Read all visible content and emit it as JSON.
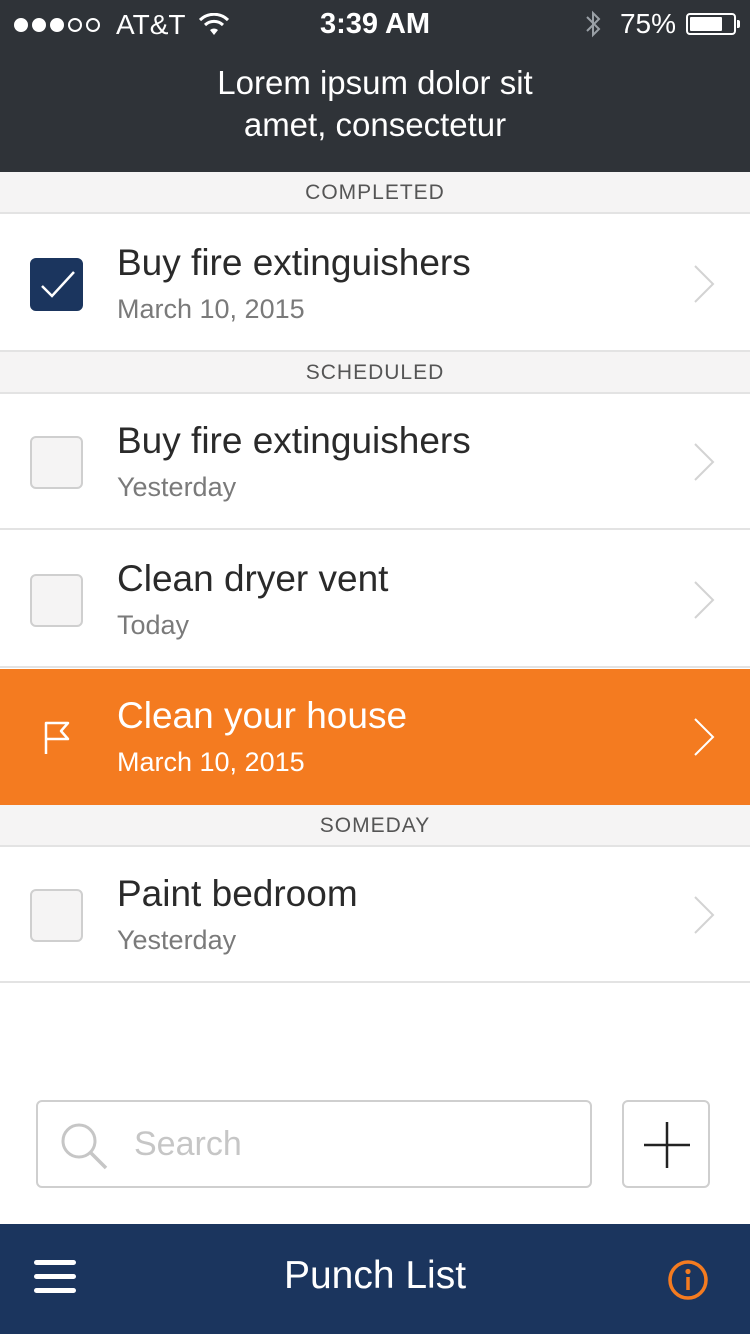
{
  "status_bar": {
    "carrier": "AT&T",
    "time": "3:39 AM",
    "battery": "75%",
    "battery_level": 0.75,
    "signal_bars_filled": 3,
    "signal_bars_total": 5
  },
  "header": {
    "title_line1": "Lorem ipsum dolor sit",
    "title_line2": "amet, consectetur"
  },
  "sections": {
    "completed": "COMPLETED",
    "scheduled": "SCHEDULED",
    "someday": "SOMEDAY"
  },
  "items": [
    {
      "title": "Buy fire extinguishers",
      "subtitle": "March 10, 2015",
      "state": "checked"
    },
    {
      "title": "Buy fire extinguishers",
      "subtitle": "Yesterday",
      "state": "unchecked"
    },
    {
      "title": "Clean dryer vent",
      "subtitle": "Today",
      "state": "unchecked"
    },
    {
      "title": "Clean your house",
      "subtitle": "March 10, 2015",
      "state": "flagged"
    },
    {
      "title": "Paint bedroom",
      "subtitle": "Yesterday",
      "state": "unchecked"
    }
  ],
  "search": {
    "placeholder": "Search",
    "value": ""
  },
  "bottom_bar": {
    "title": "Punch List"
  },
  "colors": {
    "header_bg": "#2f3338",
    "nav_bg": "#1b355e",
    "accent_orange": "#f47b20",
    "checked_bg": "#1b355e"
  },
  "icons": {
    "menu": "hamburger-menu-icon",
    "info": "info-circle-icon",
    "add": "plus-icon",
    "search": "magnifier-icon",
    "flag": "flag-icon",
    "chevron": "chevron-right-icon"
  }
}
